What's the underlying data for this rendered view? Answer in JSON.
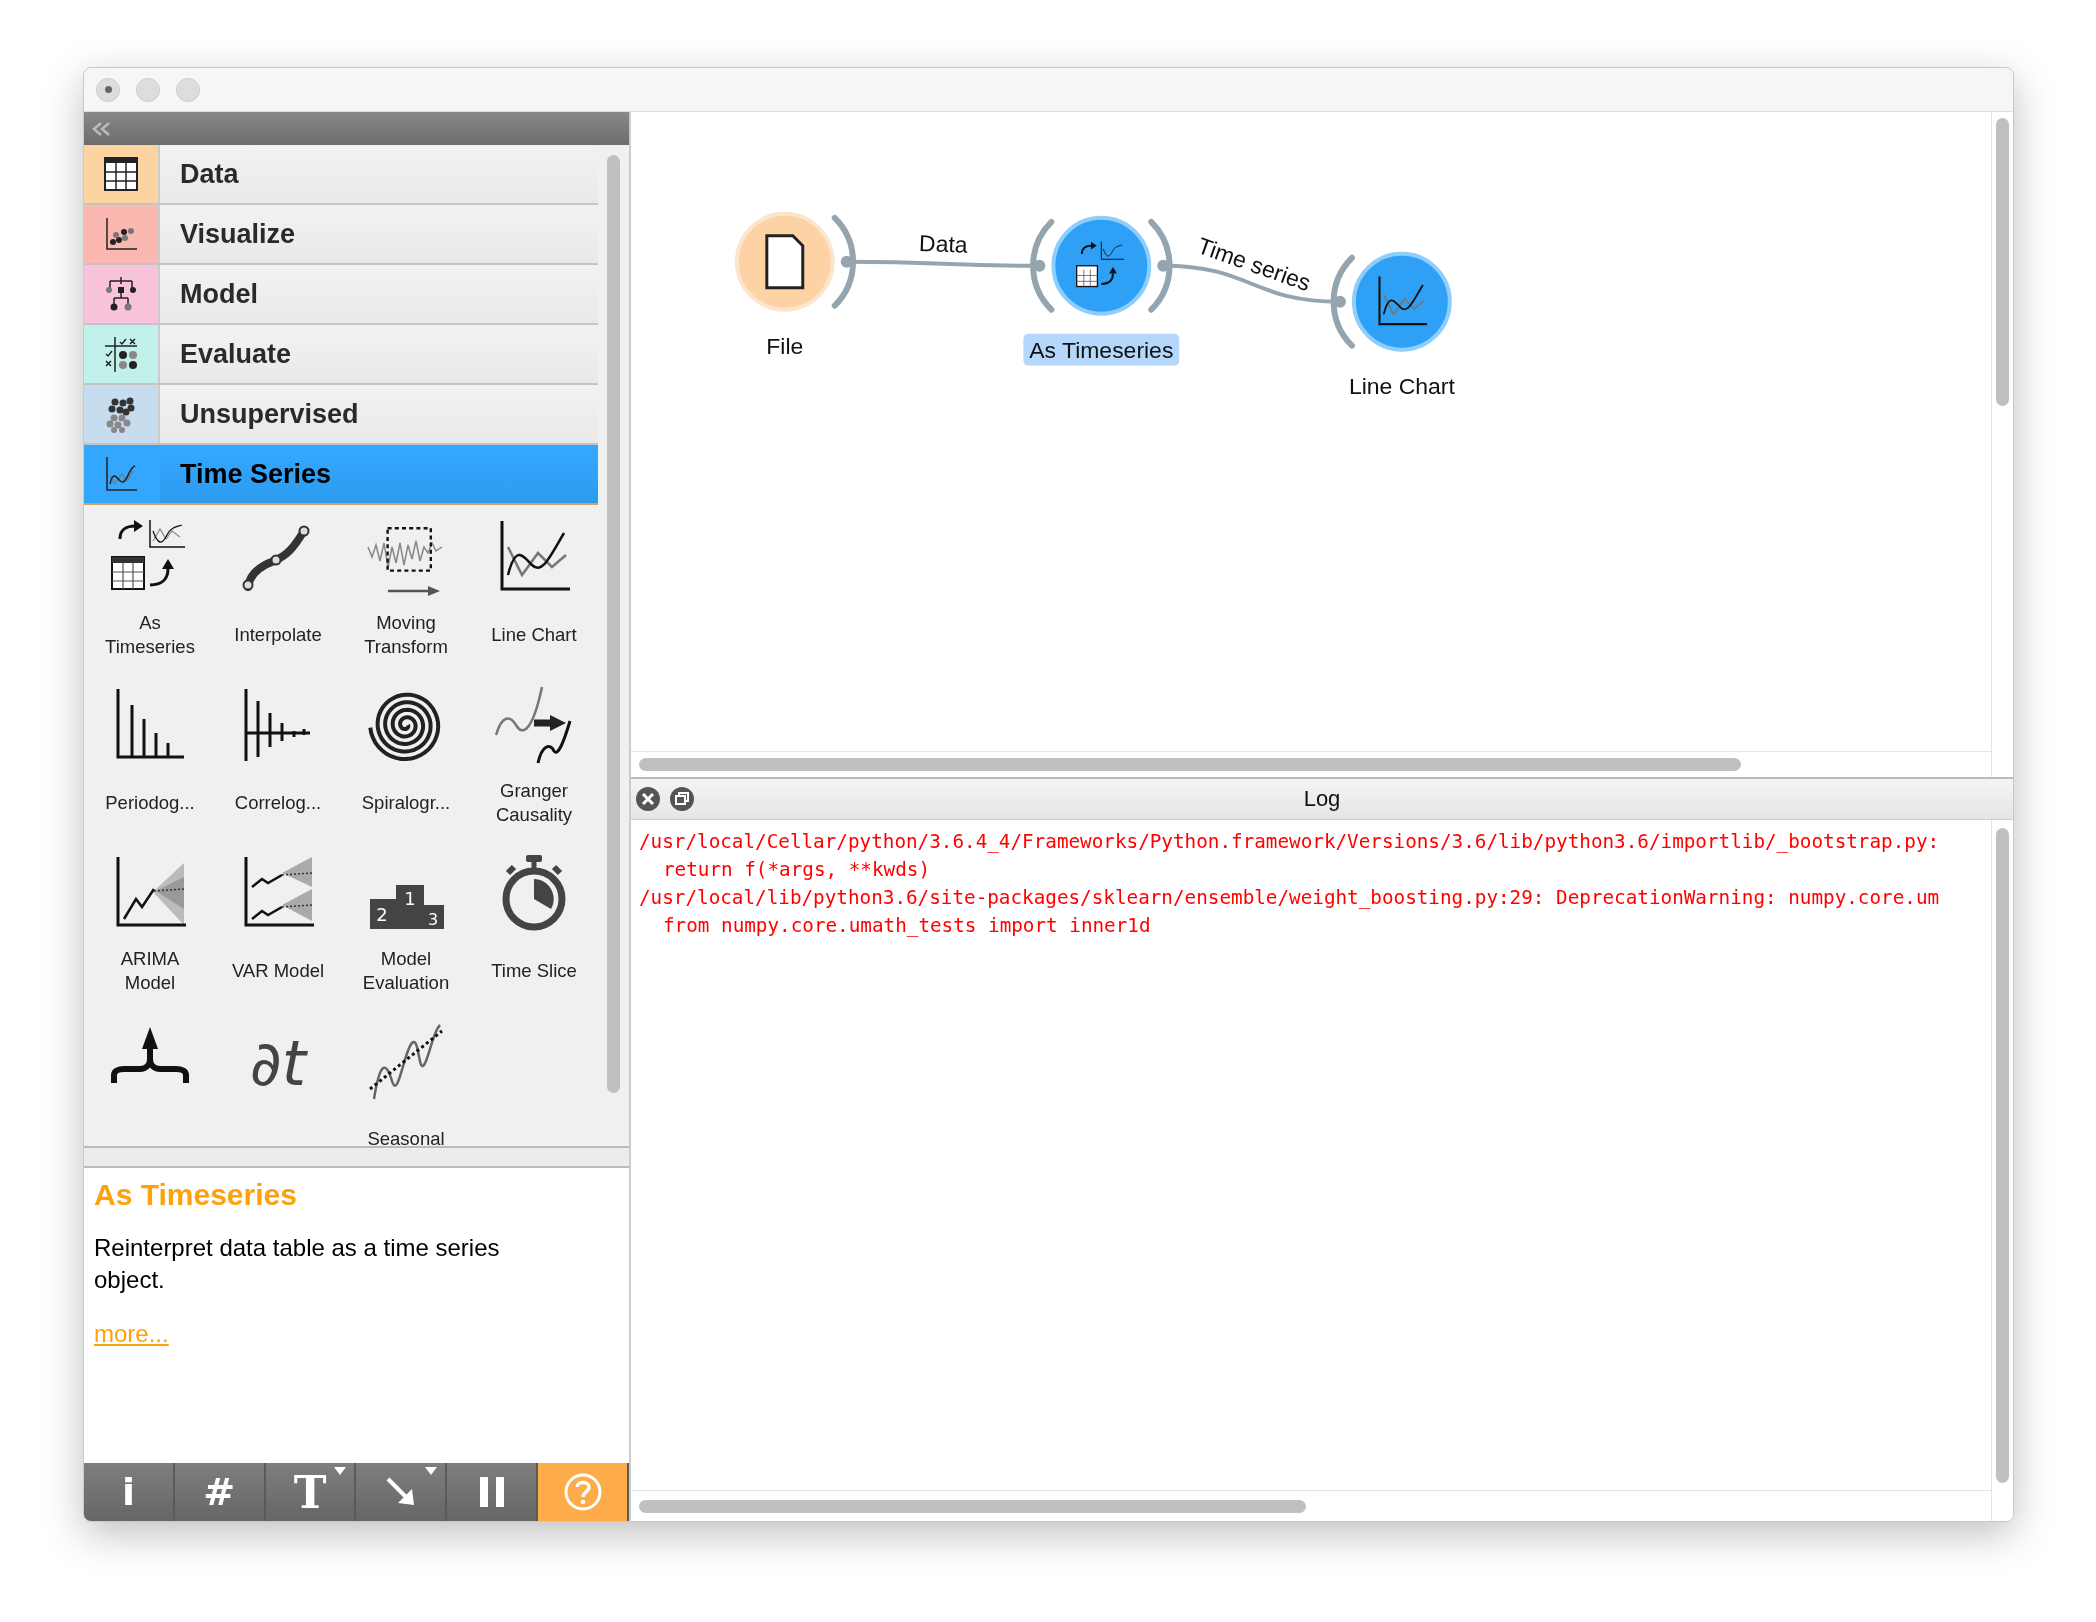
{
  "categories": [
    {
      "label": "Data",
      "kind": "data",
      "color": "#fcd4a2",
      "selected": false
    },
    {
      "label": "Visualize",
      "kind": "visualize",
      "color": "#fbb8b0",
      "selected": false
    },
    {
      "label": "Model",
      "kind": "model",
      "color": "#f9c3dc",
      "selected": false
    },
    {
      "label": "Evaluate",
      "kind": "evaluate",
      "color": "#c2f0eb",
      "selected": false
    },
    {
      "label": "Unsupervised",
      "kind": "unsupervised",
      "color": "#c7dcee",
      "selected": false
    },
    {
      "label": "Time Series",
      "kind": "timeseries",
      "color": "#33a7fe",
      "selected": true
    }
  ],
  "widgets": [
    {
      "label": "As Timeseries",
      "kind": "as_timeseries"
    },
    {
      "label": "Interpolate",
      "kind": "interpolate"
    },
    {
      "label": "Moving Transform",
      "kind": "moving_transform"
    },
    {
      "label": "Line Chart",
      "kind": "line_chart"
    },
    {
      "label": "Periodog...",
      "kind": "periodogram"
    },
    {
      "label": "Correlog...",
      "kind": "correlogram"
    },
    {
      "label": "Spiralogr...",
      "kind": "spiralogram"
    },
    {
      "label": "Granger Causality",
      "kind": "granger"
    },
    {
      "label": "ARIMA Model",
      "kind": "arima"
    },
    {
      "label": "VAR Model",
      "kind": "var"
    },
    {
      "label": "Model Evaluation",
      "kind": "model_evaluation",
      "podium": [
        "2",
        "1",
        "3"
      ]
    },
    {
      "label": "Time Slice",
      "kind": "time_slice"
    },
    {
      "kind": "aggregate"
    },
    {
      "kind": "difference",
      "glyph": "∂t"
    },
    {
      "label": "Seasonal",
      "kind": "seasonal"
    }
  ],
  "description": {
    "title": "As Timeseries",
    "text": "Reinterpret data table as a time series object.",
    "link": "more..."
  },
  "toolbar": [
    {
      "kind": "info",
      "glyph": "i",
      "dropdown": false,
      "active": false
    },
    {
      "kind": "grid",
      "glyph": "#",
      "dropdown": false,
      "active": false
    },
    {
      "kind": "text",
      "glyph": "T",
      "dropdown": true,
      "active": false
    },
    {
      "kind": "arrow",
      "dropdown": true,
      "active": false
    },
    {
      "kind": "pause",
      "dropdown": false,
      "active": false
    },
    {
      "kind": "help",
      "dropdown": false,
      "active": true
    }
  ],
  "canvas": {
    "nodes": [
      {
        "label": "File",
        "kind": "file",
        "selected": false
      },
      {
        "label": "As Timeseries",
        "kind": "as_timeseries",
        "selected": true
      },
      {
        "label": "Line Chart",
        "kind": "line_chart",
        "selected": false
      }
    ],
    "links": [
      {
        "label": "Data"
      },
      {
        "label": "Time series"
      }
    ]
  },
  "log": {
    "title": "Log",
    "lines": [
      {
        "text": "/usr/local/Cellar/python/3.6.4_4/Frameworks/Python.framework/Versions/3.6/lib/python3.6/importlib/_bootstrap.py:",
        "indent": false
      },
      {
        "text": "return f(*args, **kwds)",
        "indent": true
      },
      {
        "text": "/usr/local/lib/python3.6/site-packages/sklearn/ensemble/weight_boosting.py:29: DeprecationWarning: numpy.core.um",
        "indent": false
      },
      {
        "text": "from numpy.core.umath_tests import inner1d",
        "indent": true
      }
    ]
  }
}
